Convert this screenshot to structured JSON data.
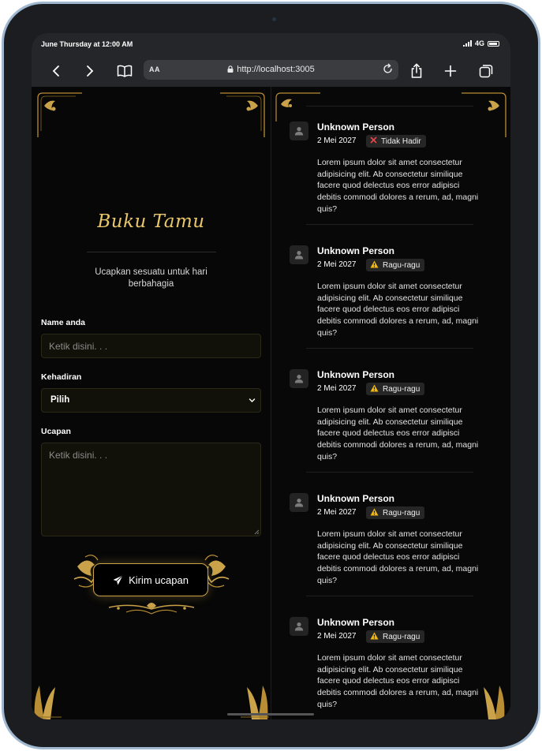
{
  "statusbar": {
    "time": "June Thursday at 12:00 AM",
    "network": "4G"
  },
  "browser": {
    "text_size": "AA",
    "url": "http://localhost:3005"
  },
  "guestbook": {
    "title": "Buku Tamu",
    "subtitle": "Ucapkan sesuatu untuk hari berbahagia",
    "name_label": "Name anda",
    "name_placeholder": "Ketik disini. . .",
    "attendance_label": "Kehadiran",
    "attendance_value": "Pilih",
    "message_label": "Ucapan",
    "message_placeholder": "Ketik disini. . .",
    "submit_label": "Kirim ucapan"
  },
  "messages": [
    {
      "name": "Unknown Person",
      "date": "2 Mei 2027",
      "status": "Tidak Hadir",
      "status_icon": "x-icon",
      "text": "Lorem ipsum dolor sit amet consectetur adipisicing elit. Ab consectetur similique facere quod delectus eos error adipisci debitis commodi dolores a rerum, ad, magni quis?"
    },
    {
      "name": "Unknown Person",
      "date": "2 Mei 2027",
      "status": "Ragu-ragu",
      "status_icon": "warning-icon",
      "text": "Lorem ipsum dolor sit amet consectetur adipisicing elit. Ab consectetur similique facere quod delectus eos error adipisci debitis commodi dolores a rerum, ad, magni quis?"
    },
    {
      "name": "Unknown Person",
      "date": "2 Mei 2027",
      "status": "Ragu-ragu",
      "status_icon": "warning-icon",
      "text": "Lorem ipsum dolor sit amet consectetur adipisicing elit. Ab consectetur similique facere quod delectus eos error adipisci debitis commodi dolores a rerum, ad, magni quis?"
    },
    {
      "name": "Unknown Person",
      "date": "2 Mei 2027",
      "status": "Ragu-ragu",
      "status_icon": "warning-icon",
      "text": "Lorem ipsum dolor sit amet consectetur adipisicing elit. Ab consectetur similique facere quod delectus eos error adipisci debitis commodi dolores a rerum, ad, magni quis?"
    },
    {
      "name": "Unknown Person",
      "date": "2 Mei 2027",
      "status": "Ragu-ragu",
      "status_icon": "warning-icon",
      "text": "Lorem ipsum dolor sit amet consectetur adipisicing elit. Ab consectetur similique facere quod delectus eos error adipisci debitis commodi dolores a rerum, ad, magni quis?"
    }
  ],
  "colors": {
    "gold": "#c9a24a",
    "title_gold": "#eac76a",
    "warning": "#f5b80d",
    "danger": "#e5484d",
    "background": "#050505"
  }
}
